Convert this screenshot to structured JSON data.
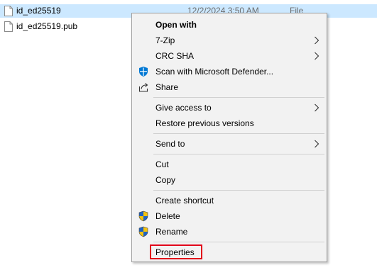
{
  "files": [
    {
      "name": "id_ed25519",
      "date": "12/2/2024 3:50 AM",
      "type": "File",
      "selected": true
    },
    {
      "name": "id_ed25519.pub",
      "date": "",
      "type": "",
      "selected": false
    }
  ],
  "menu": {
    "open_with": "Open with",
    "seven_zip": "7-Zip",
    "crc_sha": "CRC SHA",
    "scan_defender": "Scan with Microsoft Defender...",
    "share": "Share",
    "give_access": "Give access to",
    "restore_versions": "Restore previous versions",
    "send_to": "Send to",
    "cut": "Cut",
    "copy": "Copy",
    "create_shortcut": "Create shortcut",
    "delete": "Delete",
    "rename": "Rename",
    "properties": "Properties"
  },
  "colors": {
    "selection": "#cce8ff",
    "menu_bg": "#f2f2f2",
    "highlight_box": "#e2001a",
    "defender_blue": "#0078d4",
    "shield_blue": "#1e63c4",
    "shield_yellow": "#f4c20d"
  },
  "icons": [
    "file-icon",
    "defender-icon",
    "share-icon",
    "uac-shield-icon",
    "chevron-right-icon"
  ]
}
